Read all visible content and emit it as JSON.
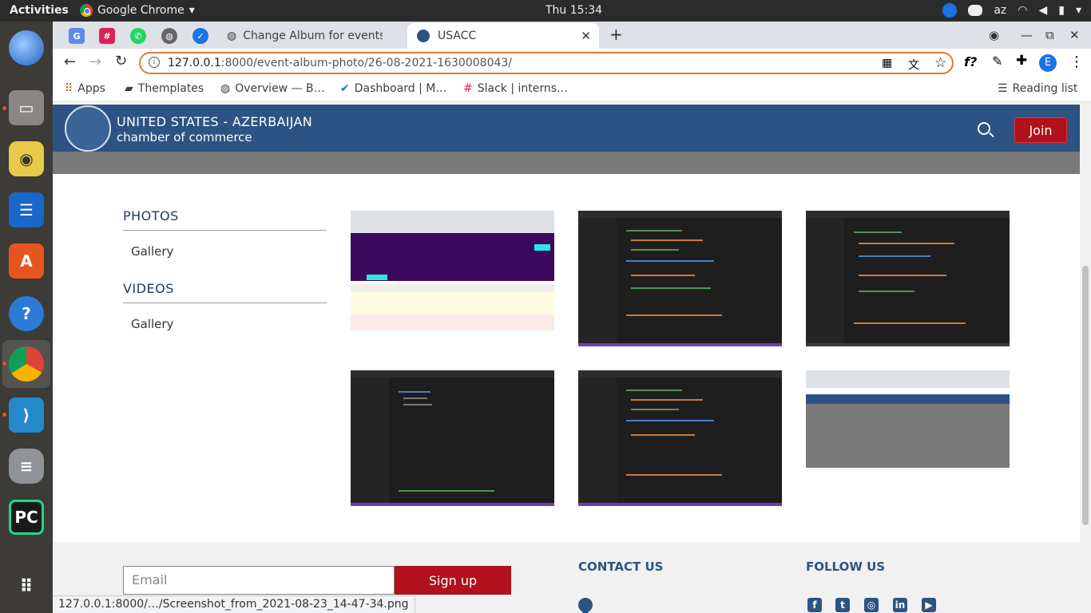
{
  "topbar": {
    "activities": "Activities",
    "app_name": "Google Chrome",
    "clock": "Thu 15:34",
    "keyboard": "az"
  },
  "dock": {
    "items": [
      "thunderbird-icon",
      "files-icon",
      "rhythmbox-icon",
      "writer-icon",
      "software-icon",
      "help-icon",
      "chrome-icon",
      "vscode-icon",
      "database-icon",
      "pycharm-icon",
      "apps-grid-icon"
    ]
  },
  "tabs": [
    {
      "label": "Change Album for events",
      "active": false
    },
    {
      "label": "USACC",
      "active": true
    }
  ],
  "address": {
    "host": "127.0.0.1",
    "rest": ":8000/event-album-photo/26-08-2021-1630008043/"
  },
  "bookmarks": [
    "Apps",
    "Themplates",
    "Overview — B…",
    "Dashboard | M…",
    "Slack | interns…"
  ],
  "reading_list": "Reading list",
  "site": {
    "brand_line1": "UNITED STATES - AZERBAIJAN",
    "brand_line2": "chamber of commerce",
    "join": "Join"
  },
  "sidebar": {
    "photos_title": "PHOTOS",
    "photos_link": "Gallery",
    "videos_title": "VIDEOS",
    "videos_link": "Gallery"
  },
  "gallery": [
    "screenshot-1",
    "screenshot-2",
    "screenshot-3",
    "screenshot-4",
    "screenshot-5",
    "screenshot-6"
  ],
  "footer": {
    "email_placeholder": "Email",
    "signup": "Sign up",
    "contact": "CONTACT US",
    "follow": "FOLLOW US"
  },
  "status_url": "127.0.0.1:8000/…/Screenshot_from_2021-08-23_14-47-34.png"
}
